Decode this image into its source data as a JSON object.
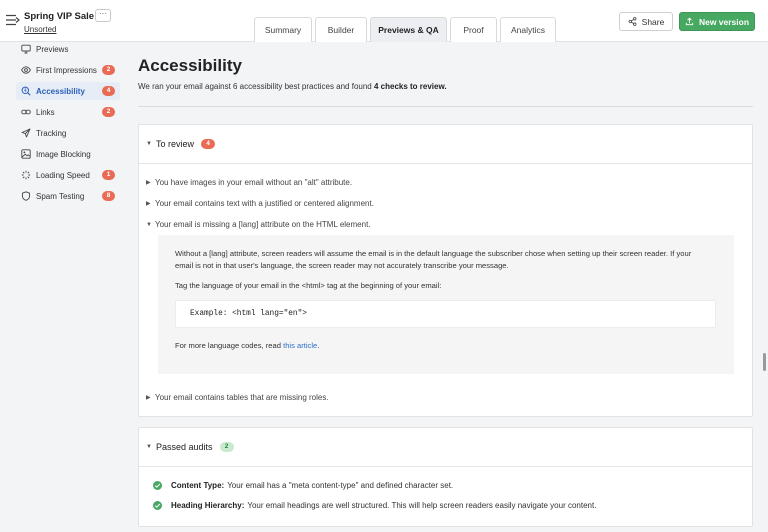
{
  "header": {
    "email_name": "Spring VIP Sale",
    "more_label": "···",
    "folder": "Unsorted",
    "tabs": [
      {
        "label": "Summary"
      },
      {
        "label": "Builder"
      },
      {
        "label": "Previews & QA"
      },
      {
        "label": "Proof"
      },
      {
        "label": "Analytics"
      }
    ],
    "share_label": "Share",
    "new_version_label": "New version"
  },
  "sidebar": {
    "items": [
      {
        "label": "Previews",
        "icon": "monitor-icon"
      },
      {
        "label": "First Impressions",
        "icon": "eye-icon",
        "badge": "2"
      },
      {
        "label": "Accessibility",
        "icon": "accessibility-search-icon",
        "badge": "4"
      },
      {
        "label": "Links",
        "icon": "link-icon",
        "badge": "2"
      },
      {
        "label": "Tracking",
        "icon": "send-icon"
      },
      {
        "label": "Image Blocking",
        "icon": "image-icon"
      },
      {
        "label": "Loading Speed",
        "icon": "loader-icon",
        "badge": "1"
      },
      {
        "label": "Spam Testing",
        "icon": "shield-icon",
        "badge": "8"
      }
    ]
  },
  "main": {
    "title": "Accessibility",
    "desc_pre": "We ran your email against 6 accessibility best practices and found ",
    "desc_bold": "4 checks to review.",
    "to_review": {
      "title": "To review",
      "count": "4",
      "issues": [
        "You have images in your email without an \"alt\" attribute.",
        "Your email contains text with a justified or centered alignment.",
        "Your email is missing a [lang] attribute on the HTML element.",
        "Your email contains tables that are missing roles."
      ],
      "detail": {
        "para1_line1": "Without a [lang] attribute, screen readers will assume the email is in the default language the subscriber chose when setting up their screen reader. If your",
        "para1_line2": "email is not in that user's language, the screen reader may not accurately transcribe your message.",
        "para2": "Tag the language of your email in the <html> tag at the beginning of your email:",
        "code": "Example: <html lang=\"en\">",
        "more_pre": "For more language codes, read ",
        "more_link": "this article",
        "more_post": "."
      }
    },
    "passed": {
      "title": "Passed audits",
      "count": "2",
      "items": [
        {
          "label": "Content Type:",
          "text": "Your email has a \"meta content-type\" and defined character set."
        },
        {
          "label": "Heading Hierarchy:",
          "text": "Your email headings are well structured. This will help screen readers easily navigate your content."
        }
      ]
    }
  }
}
